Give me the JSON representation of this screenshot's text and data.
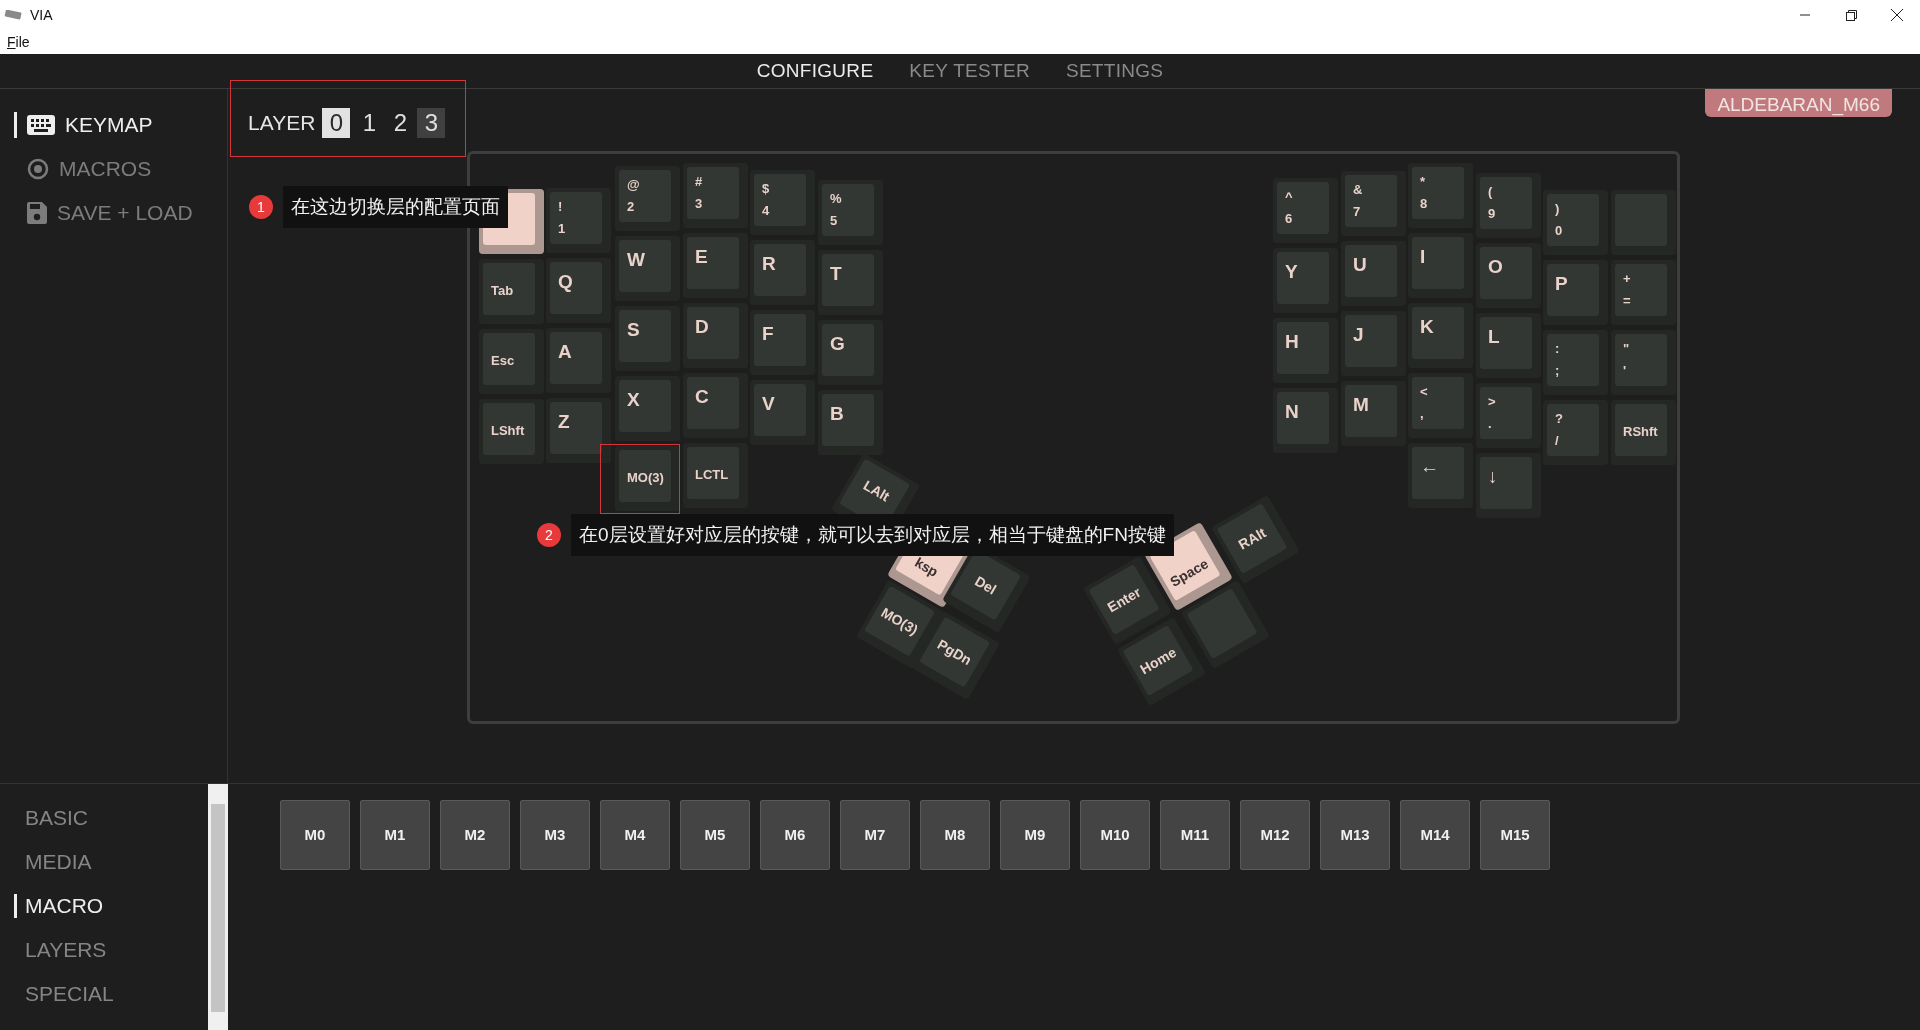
{
  "window": {
    "title": "VIA"
  },
  "menu": [
    "File"
  ],
  "top_tabs": [
    {
      "label": "CONFIGURE",
      "selected": true
    },
    {
      "label": "KEY TESTER",
      "selected": false
    },
    {
      "label": "SETTINGS",
      "selected": false
    }
  ],
  "sidebar": {
    "items": [
      {
        "label": "KEYMAP",
        "selected": true
      },
      {
        "label": "MACROS",
        "selected": false
      },
      {
        "label": "SAVE + LOAD",
        "selected": false
      }
    ]
  },
  "layer_selector": {
    "label": "LAYER",
    "layers": [
      {
        "label": "0",
        "selected": true,
        "hover": false
      },
      {
        "label": "1",
        "selected": false,
        "hover": false
      },
      {
        "label": "2",
        "selected": false,
        "hover": false
      },
      {
        "label": "3",
        "selected": false,
        "hover": true
      }
    ]
  },
  "device_badge": "ALDEBARAN_M66",
  "keyboard": {
    "left_columns": [
      [
        {
          "color": "#f0d2c9"
        },
        {
          "legends": [
            "Tab"
          ],
          "color": "#323733"
        },
        {
          "legends": [
            "Esc"
          ],
          "color": "#323733"
        },
        {
          "legends": [
            "LShft"
          ],
          "color": "#323733"
        }
      ],
      [
        {
          "legends": [
            "!",
            "1"
          ],
          "color": "#323733"
        },
        {
          "legends": [
            "Q"
          ],
          "color": "#323733"
        },
        {
          "legends": [
            "A"
          ],
          "color": "#323733"
        },
        {
          "legends": [
            "Z"
          ],
          "color": "#323733"
        }
      ],
      [
        {
          "legends": [
            "@",
            "2"
          ],
          "color": "#323733"
        },
        {
          "legends": [
            "W"
          ],
          "color": "#323733"
        },
        {
          "legends": [
            "S"
          ],
          "color": "#323733"
        },
        {
          "legends": [
            "X"
          ],
          "color": "#323733"
        },
        {
          "legends": [
            "MO(3)"
          ],
          "color": "#323733"
        }
      ],
      [
        {
          "legends": [
            "#",
            "3"
          ],
          "color": "#323733"
        },
        {
          "legends": [
            "E"
          ],
          "color": "#323733"
        },
        {
          "legends": [
            "D"
          ],
          "color": "#323733"
        },
        {
          "legends": [
            "C"
          ],
          "color": "#323733"
        },
        {
          "legends": [
            "LCTL"
          ],
          "color": "#323733"
        }
      ],
      [
        {
          "legends": [
            "$",
            "4"
          ],
          "color": "#323733"
        },
        {
          "legends": [
            "R"
          ],
          "color": "#323733"
        },
        {
          "legends": [
            "F"
          ],
          "color": "#323733"
        },
        {
          "legends": [
            "V"
          ],
          "color": "#323733"
        }
      ],
      [
        {
          "legends": [
            "%",
            "5"
          ],
          "color": "#323733"
        },
        {
          "legends": [
            "T"
          ],
          "color": "#323733"
        },
        {
          "legends": [
            "G"
          ],
          "color": "#323733"
        },
        {
          "legends": [
            "B"
          ],
          "color": "#323733"
        }
      ]
    ],
    "right_columns": [
      [
        {
          "legends": [
            "^",
            "6"
          ],
          "color": "#323733"
        },
        {
          "legends": [
            "Y"
          ],
          "color": "#323733"
        },
        {
          "legends": [
            "H"
          ],
          "color": "#323733"
        },
        {
          "legends": [
            "N"
          ],
          "color": "#323733"
        }
      ],
      [
        {
          "legends": [
            "&",
            "7"
          ],
          "color": "#323733"
        },
        {
          "legends": [
            "U"
          ],
          "color": "#323733"
        },
        {
          "legends": [
            "J"
          ],
          "color": "#323733"
        },
        {
          "legends": [
            "M"
          ],
          "color": "#323733"
        }
      ],
      [
        {
          "legends": [
            "*",
            "8"
          ],
          "color": "#323733"
        },
        {
          "legends": [
            "I"
          ],
          "color": "#323733"
        },
        {
          "legends": [
            "K"
          ],
          "color": "#323733"
        },
        {
          "legends": [
            "<",
            ","
          ],
          "color": "#323733"
        },
        {
          "legends": [
            "←"
          ],
          "color": "#323733"
        }
      ],
      [
        {
          "legends": [
            "(",
            "9"
          ],
          "color": "#323733"
        },
        {
          "legends": [
            "O"
          ],
          "color": "#323733"
        },
        {
          "legends": [
            "L"
          ],
          "color": "#323733"
        },
        {
          "legends": [
            ">",
            "."
          ],
          "color": "#323733"
        },
        {
          "legends": [
            "↓"
          ],
          "color": "#323733"
        }
      ],
      [
        {
          "legends": [
            ")",
            "0"
          ],
          "color": "#323733"
        },
        {
          "legends": [
            "P"
          ],
          "color": "#323733"
        },
        {
          "legends": [
            ":",
            ";"
          ],
          "color": "#323733"
        },
        {
          "legends": [
            "?",
            "/"
          ],
          "color": "#323733"
        }
      ],
      [
        {
          "color": "#323733"
        },
        {
          "legends": [
            "+",
            "="
          ],
          "color": "#323733"
        },
        {
          "legends": [
            "\"",
            "'"
          ],
          "color": "#323733"
        },
        {
          "legends": [
            "RShft"
          ],
          "color": "#323733"
        }
      ]
    ],
    "left_thumb": [
      {
        "legends": [
          "LAlt"
        ],
        "color": "#323733"
      },
      {
        "legends": [
          "ksp"
        ],
        "color": "#f0d2c9"
      },
      {
        "legends": [
          "Del"
        ],
        "color": "#323733"
      },
      {
        "legends": [
          "MO(3)"
        ],
        "color": "#323733"
      },
      {
        "legends": [
          "PgDn"
        ],
        "color": "#323733"
      }
    ],
    "right_thumb": [
      {
        "legends": [
          "RAlt"
        ],
        "color": "#323733"
      },
      {
        "legends": [
          "Space"
        ],
        "color": "#f0d2c9"
      },
      {
        "legends": [
          "Enter"
        ],
        "color": "#323733"
      },
      {
        "legends": [
          "Home"
        ],
        "color": "#323733"
      },
      {
        "color": "#323733"
      }
    ]
  },
  "annotations": [
    {
      "number": "1",
      "text": "在这边切换层的配置页面"
    },
    {
      "number": "2",
      "text": "在0层设置好对应层的按键，就可以去到对应层，相当于键盘的FN按键"
    }
  ],
  "keycode_categories": [
    {
      "label": "BASIC",
      "selected": false
    },
    {
      "label": "MEDIA",
      "selected": false
    },
    {
      "label": "MACRO",
      "selected": true
    },
    {
      "label": "LAYERS",
      "selected": false
    },
    {
      "label": "SPECIAL",
      "selected": false
    }
  ],
  "macro_keys": [
    "M0",
    "M1",
    "M2",
    "M3",
    "M4",
    "M5",
    "M6",
    "M7",
    "M8",
    "M9",
    "M10",
    "M11",
    "M12",
    "M13",
    "M14",
    "M15"
  ]
}
